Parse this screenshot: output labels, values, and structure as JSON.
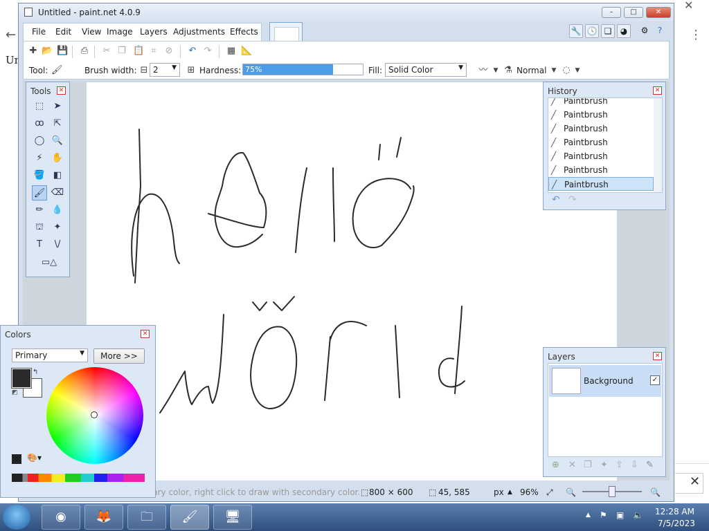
{
  "background": {
    "back_glyph": "←",
    "partial_text": "Un",
    "close_glyph": "✕",
    "dots_glyph": "⋮"
  },
  "window": {
    "title": "Untitled - paint.net 4.0.9",
    "min": "–",
    "max": "□",
    "close": "✕"
  },
  "menu": [
    "File",
    "Edit",
    "View",
    "Image",
    "Layers",
    "Adjustments",
    "Effects"
  ],
  "toolbar": {
    "tool_label": "Tool:",
    "brush_width_label": "Brush width:",
    "brush_width_value": "2",
    "hardness_label": "Hardness:",
    "hardness_value": "75%",
    "hardness_fraction": 0.75,
    "fill_label": "Fill:",
    "fill_value": "Solid Color",
    "blend_mode": "Normal"
  },
  "tools_panel": {
    "title": "Tools"
  },
  "history": {
    "title": "History",
    "items": [
      "Paintbrush",
      "Paintbrush",
      "Paintbrush",
      "Paintbrush",
      "Paintbrush",
      "Paintbrush",
      "Paintbrush"
    ]
  },
  "layers": {
    "title": "Layers",
    "items": [
      {
        "name": "Background",
        "visible": true
      }
    ],
    "checkbox_glyph": "✓"
  },
  "colors": {
    "title": "Colors",
    "mode": "Primary",
    "more_button": "More >>",
    "primary_color": "#2b2b2b",
    "secondary_color": "#ffffff"
  },
  "status": {
    "hint": "Left click to draw with primary color, right click to draw with secondary color.",
    "image_size": "800 × 600",
    "cursor_pos": "45, 585",
    "units": "px",
    "zoom": "96%"
  },
  "taskbar": {
    "time": "12:28 AM",
    "date": "7/5/2023"
  }
}
